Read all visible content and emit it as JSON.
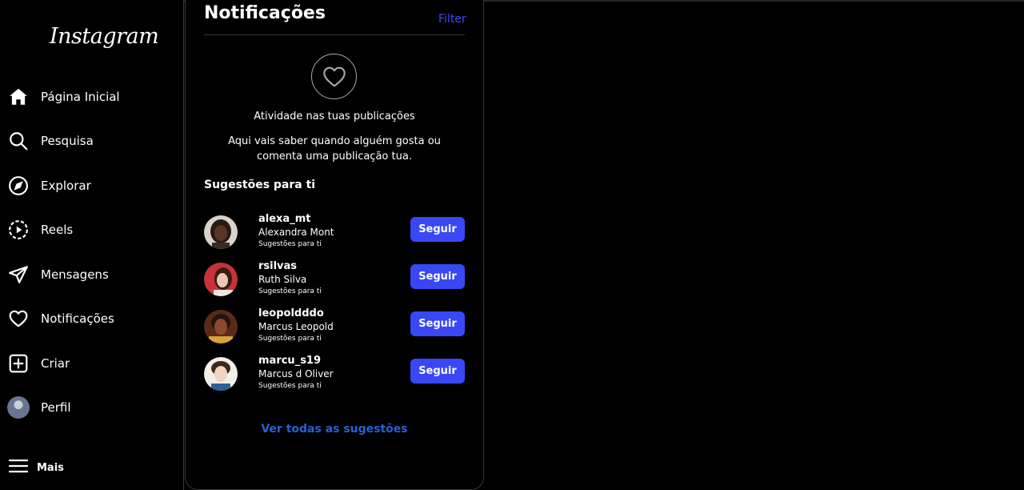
{
  "app": {
    "logo": "Instagram"
  },
  "sidebar": {
    "items": [
      {
        "label": "Página Inicial",
        "icon": "home-icon"
      },
      {
        "label": "Pesquisa",
        "icon": "search-icon"
      },
      {
        "label": "Explorar",
        "icon": "compass-icon"
      },
      {
        "label": "Reels",
        "icon": "reels-icon"
      },
      {
        "label": "Mensagens",
        "icon": "send-icon"
      },
      {
        "label": "Notificações",
        "icon": "heart-icon"
      },
      {
        "label": "Criar",
        "icon": "plus-square-icon"
      },
      {
        "label": "Perfil",
        "icon": "avatar"
      }
    ],
    "more_label": "Mais"
  },
  "notifications": {
    "title": "Notificações",
    "filter_label": "Filter",
    "activity_title": "Atividade nas tuas publicações",
    "activity_desc": "Aqui vais saber quando alguém gosta ou comenta uma publicação tua.",
    "suggestions_heading": "Sugestões para ti",
    "suggestions": [
      {
        "username": "alexa_mt",
        "name": "Alexandra Mont",
        "sub": "Sugestões para ti",
        "button": "Seguir"
      },
      {
        "username": "rsilvas",
        "name": "Ruth Silva",
        "sub": "Sugestões para ti",
        "button": "Seguir"
      },
      {
        "username": "leopoldddo",
        "name": "Marcus Leopold",
        "sub": "Sugestões para ti",
        "button": "Seguir"
      },
      {
        "username": "marcu_s19",
        "name": "Marcus d Oliver",
        "sub": "Sugestões para ti",
        "button": "Seguir"
      }
    ],
    "see_all": "Ver todas as sugestões"
  },
  "colors": {
    "accent": "#3a47f5",
    "link": "#2c5fd8",
    "background": "#000000"
  }
}
